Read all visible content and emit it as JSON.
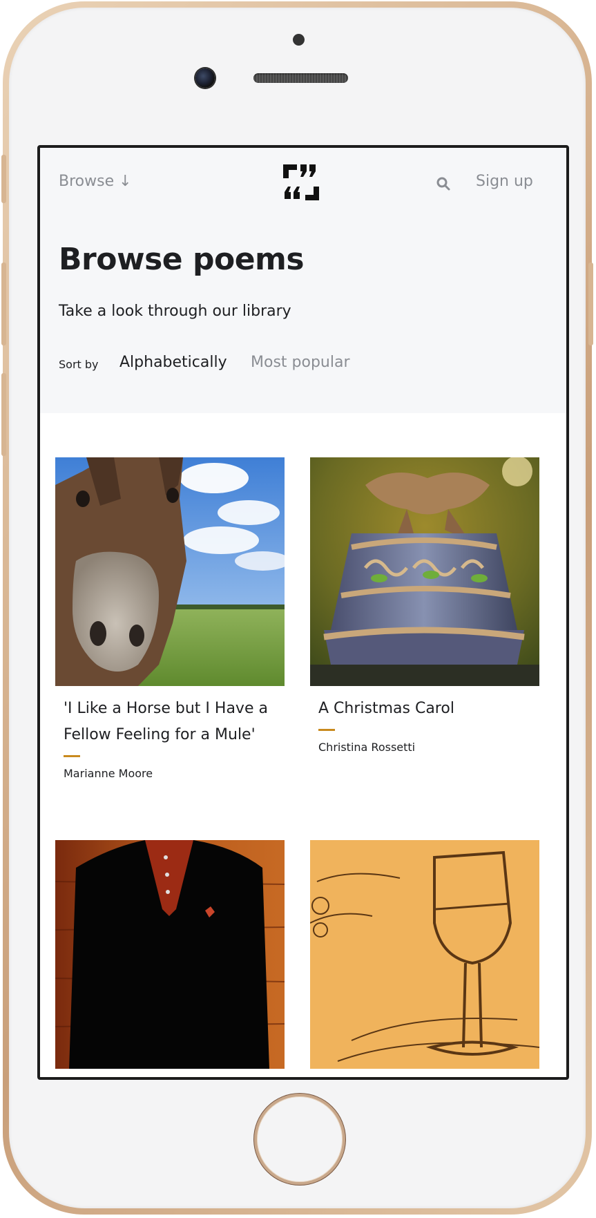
{
  "nav": {
    "browse_label": "Browse ↓",
    "signup_label": "Sign up"
  },
  "header": {
    "title": "Browse poems",
    "subtitle": "Take a look through our library"
  },
  "sort": {
    "label": "Sort by",
    "options": [
      "Alphabetically",
      "Most popular"
    ],
    "selected": "Alphabetically"
  },
  "poems": [
    {
      "title": "'I Like a Horse but I Have a Fellow Feeling for a Mule'",
      "author": "Marianne Moore",
      "image": "donkey-in-field"
    },
    {
      "title": "A Christmas Carol",
      "author": "Christina Rossetti",
      "image": "ornate-bell-ornament"
    },
    {
      "title": "",
      "author": "",
      "image": "man-in-black-sweater"
    },
    {
      "title": "",
      "author": "",
      "image": "wine-glass-sketch"
    }
  ],
  "colors": {
    "accent": "#c98a1e",
    "text": "#1e1f22",
    "muted": "#8a8d93",
    "header_bg": "#f6f7f9"
  }
}
